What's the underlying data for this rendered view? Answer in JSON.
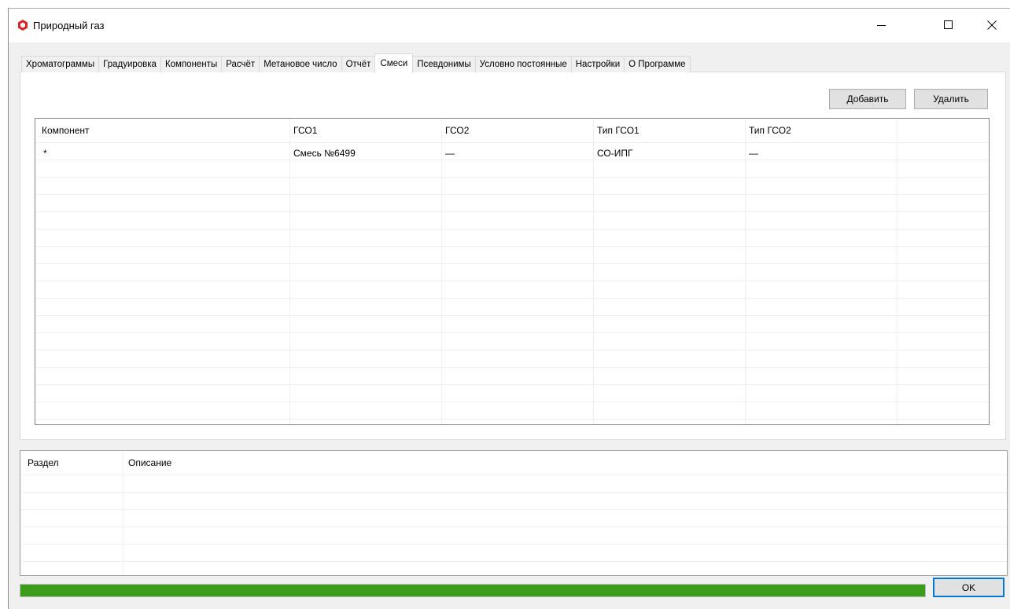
{
  "window": {
    "title": "Природный газ",
    "minimize_glyph": "—",
    "maximize_glyph": "☐",
    "close_glyph": "✕"
  },
  "tabs": [
    {
      "label": "Хроматограммы",
      "active": false
    },
    {
      "label": "Градуировка",
      "active": false
    },
    {
      "label": "Компоненты",
      "active": false
    },
    {
      "label": "Расчёт",
      "active": false
    },
    {
      "label": "Метановое число",
      "active": false
    },
    {
      "label": "Отчёт",
      "active": false
    },
    {
      "label": "Смеси",
      "active": true
    },
    {
      "label": "Псевдонимы",
      "active": false
    },
    {
      "label": "Условно постоянные",
      "active": false
    },
    {
      "label": "Настройки",
      "active": false
    },
    {
      "label": "О Программе",
      "active": false
    }
  ],
  "toolbar": {
    "add_label": "Добавить",
    "delete_label": "Удалить"
  },
  "mixtures_table": {
    "columns": [
      "Компонент",
      "ГСО1",
      "ГСО2",
      "Тип ГСО1",
      "Тип ГСО2"
    ],
    "rows": [
      [
        "*",
        "Смесь №6499",
        "—",
        "СО-ИПГ",
        "—"
      ]
    ]
  },
  "log_table": {
    "columns": [
      "Раздел",
      "Описание"
    ],
    "rows": []
  },
  "progress": {
    "value_percent": 100,
    "color": "#3c9d1c"
  },
  "footer": {
    "ok_label": "OK"
  },
  "colors": {
    "app_icon": "#d9242b",
    "focus_border": "#0078d7"
  }
}
